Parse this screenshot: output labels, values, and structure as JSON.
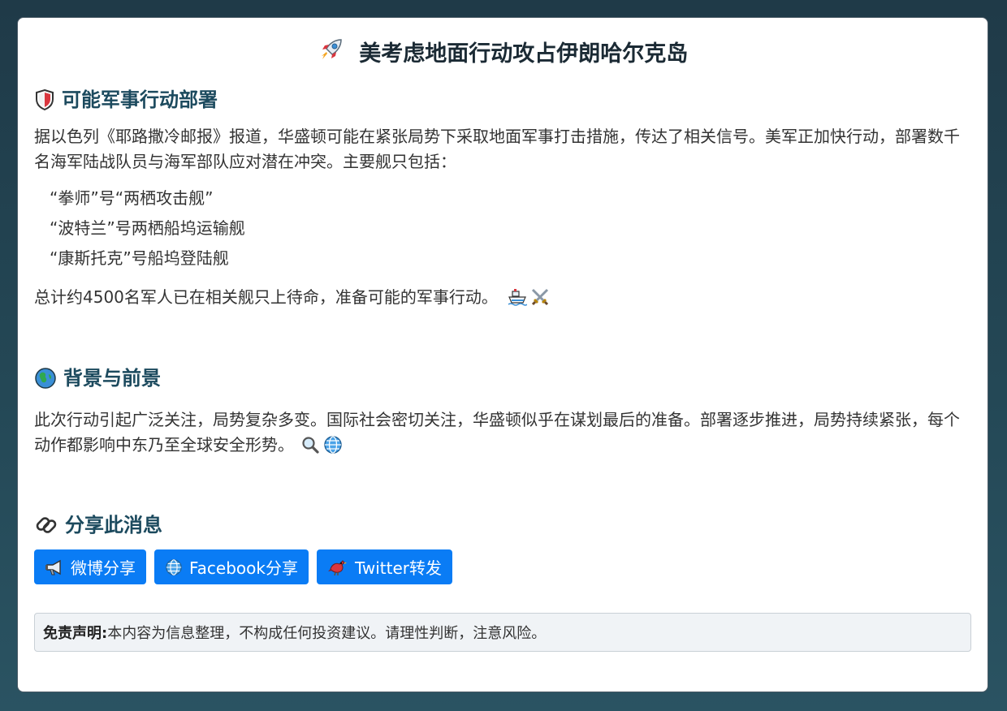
{
  "article": {
    "title": "美考虑地面行动攻占伊朗哈尔克岛",
    "title_icon": "rocket-icon"
  },
  "deployment": {
    "heading": "可能军事行动部署",
    "heading_icon": "shield-icon",
    "intro": "据以色列《耶路撒冷邮报》报道，华盛顿可能在紧张局势下采取地面军事打击措施，传达了相关信号。美军正加快行动，部署数千名海军陆战队员与海军部队应对潜在冲突。主要舰只包括：",
    "ships": [
      "“拳师”号“两栖攻击舰”",
      "“波特兰”号两栖船坞运输舰",
      "“康斯托克”号船坞登陆舰"
    ],
    "summary": "总计约4500名军人已在相关舰只上待命，准备可能的军事行动。",
    "summary_icons": [
      "ship-icon",
      "crossed-swords-icon"
    ]
  },
  "background": {
    "heading": "背景与前景",
    "heading_icon": "globe-icon",
    "text": "此次行动引起广泛关注，局势复杂多变。国际社会密切关注，华盛顿似乎在谋划最后的准备。部署逐步推进，局势持续紧张，每个动作都影响中东乃至全球安全形势。",
    "text_icons": [
      "magnifier-icon",
      "globe-meridians-icon"
    ]
  },
  "share": {
    "heading": "分享此消息",
    "heading_icon": "link-icon",
    "buttons": [
      {
        "label": "微博分享",
        "icon": "megaphone-icon"
      },
      {
        "label": "Facebook分享",
        "icon": "globe-meridians-icon"
      },
      {
        "label": "Twitter转发",
        "icon": "bird-icon"
      }
    ]
  },
  "disclaimer": {
    "label": "免责声明:",
    "text": "本内容为信息整理，不构成任何投资建议。请理性判断，注意风险。"
  },
  "colors": {
    "background": "#244856",
    "heading": "#1c4a5e",
    "button": "#0a7cf5",
    "disclaimer_bg": "#f0f3f6"
  }
}
